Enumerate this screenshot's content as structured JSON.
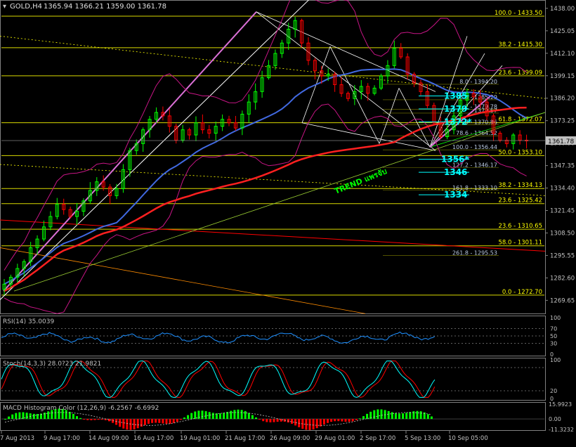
{
  "header": {
    "symbol_label": "GOLD,H4",
    "ohlc": "1365.94 1366.21 1359.00 1361.78"
  },
  "colors": {
    "background": "#000000",
    "frame": "#808080",
    "bull_candle": "#00ff00",
    "bear_candle": "#ff0000",
    "ma_fast": "#4169e1",
    "ma_slow": "#ff2020",
    "bollinger": "#c71585",
    "fib_levels": "#ffff00",
    "fib_label": "#ffff00",
    "trend_white": "#ffffff",
    "trend_violet": "#da70d6",
    "trend_label": "#00ff00",
    "cyan_label": "#00ffff",
    "rsi_line": "#1e90ff",
    "stoch_main": "#00ffff",
    "stoch_signal": "#ff0000",
    "macd_pos": "#00ff00",
    "macd_neg": "#ff0000"
  },
  "chart_data": [
    {
      "type": "line",
      "panel": "price",
      "ylim": [
        1262.5,
        1442.0
      ],
      "price_axis_ticks": [
        "1438.00",
        "1425.05",
        "1412.10",
        "1399.15",
        "1386.20",
        "1373.25",
        "1360.30",
        "1347.35",
        "1334.40",
        "1321.45",
        "1308.50",
        "1295.55",
        "1282.60",
        "1269.65"
      ],
      "current_price_tag": "1361.78",
      "x_tick_labels": [
        "7 Aug 2013",
        "9 Aug 17:00",
        "14 Aug 09:00",
        "16 Aug 17:00",
        "19 Aug 01:00",
        "21 Aug 17:00",
        "26 Aug 09:00",
        "29 Aug 01:00",
        "2 Sep 17:00",
        "5 Sep 13:00",
        "10 Sep 05:00"
      ],
      "close_series": [
        1279,
        1283,
        1288,
        1292,
        1300,
        1305,
        1312,
        1318,
        1325,
        1322,
        1318,
        1321,
        1327,
        1333,
        1338,
        1335,
        1330,
        1334,
        1345,
        1356,
        1360,
        1368,
        1374,
        1378,
        1376,
        1370,
        1362,
        1368,
        1365,
        1372,
        1368,
        1366,
        1370,
        1374,
        1372,
        1369,
        1377,
        1384,
        1390,
        1398,
        1405,
        1412,
        1418,
        1426,
        1431,
        1418,
        1408,
        1402,
        1399,
        1400,
        1394,
        1389,
        1386,
        1390,
        1393,
        1389,
        1392,
        1399,
        1405,
        1415,
        1410,
        1400,
        1395,
        1390,
        1382,
        1372,
        1364,
        1368,
        1376,
        1385,
        1389,
        1387,
        1384,
        1376,
        1366,
        1362,
        1360,
        1365,
        1362,
        1361.78
      ],
      "fib_levels": [
        {
          "label": "100.0 - 1433.50",
          "value": 1433.5
        },
        {
          "label": "38.2 - 1415.30",
          "value": 1415.3
        },
        {
          "label": "23.6 - 1399.09",
          "value": 1399.09
        },
        {
          "label": "61.8 - 1372.07",
          "value": 1372.07
        },
        {
          "label": "50.0 - 1353.10",
          "value": 1353.1
        },
        {
          "label": "38.2 - 1334.13",
          "value": 1334.13
        },
        {
          "label": "23.6 - 1325.42",
          "value": 1325.42
        },
        {
          "label": "23.6 - 1310.65",
          "value": 1310.65
        },
        {
          "label": "58.0 - 1301.11",
          "value": 1301.11
        },
        {
          "label": "0.0 - 1272.70",
          "value": 1272.7
        }
      ],
      "fib_small_labels": [
        {
          "label": "8.0 - 1394.20",
          "value": 1394.2
        },
        {
          "label": "3.6 - 1385.29",
          "value": 1385.29
        },
        {
          "label": "2 - 1379.78",
          "value": 1379.78
        },
        {
          "label": "1379.57",
          "value": 1377.6
        },
        {
          "label": "8 - 1370.86",
          "value": 1370.86
        },
        {
          "label": "78.6 - 1364.52",
          "value": 1364.52
        },
        {
          "label": "100.0 - 1356.44",
          "value": 1356.44
        },
        {
          "label": "127.2 - 1346.17",
          "value": 1346.17
        },
        {
          "label": "161.8 - 1333.10",
          "value": 1333.1
        },
        {
          "label": "261.8 - 1295.53",
          "value": 1295.53
        }
      ],
      "target_labels": [
        {
          "label": "1385",
          "value": 1387.5
        },
        {
          "label": "1379",
          "value": 1380.0
        },
        {
          "label": "1372*",
          "value": 1372.5
        },
        {
          "label": "1356*",
          "value": 1351.0
        },
        {
          "label": "1346",
          "value": 1343.5
        },
        {
          "label": "1334",
          "value": 1330.5
        }
      ],
      "trend_annotation": "TREND แพรจับ"
    },
    {
      "type": "line",
      "panel": "rsi",
      "title": "RSI(14) 35.0039",
      "ylim": [
        0,
        100
      ],
      "levels": [
        "100",
        "70",
        "50",
        "30",
        "0"
      ]
    },
    {
      "type": "line",
      "panel": "stochastic",
      "title": "Stoch(14,3,3) 28.0?23 21.9821",
      "ylim": [
        0,
        100
      ],
      "levels": [
        "100",
        "20",
        "0"
      ]
    },
    {
      "type": "bar",
      "panel": "macd",
      "title": "MACD Histogram Color (12,26,9) -6.2567 -6.6992",
      "ylim": [
        -11.3232,
        15.9923
      ],
      "levels": [
        "15.9923",
        "0.00",
        "-11.3232"
      ]
    }
  ]
}
